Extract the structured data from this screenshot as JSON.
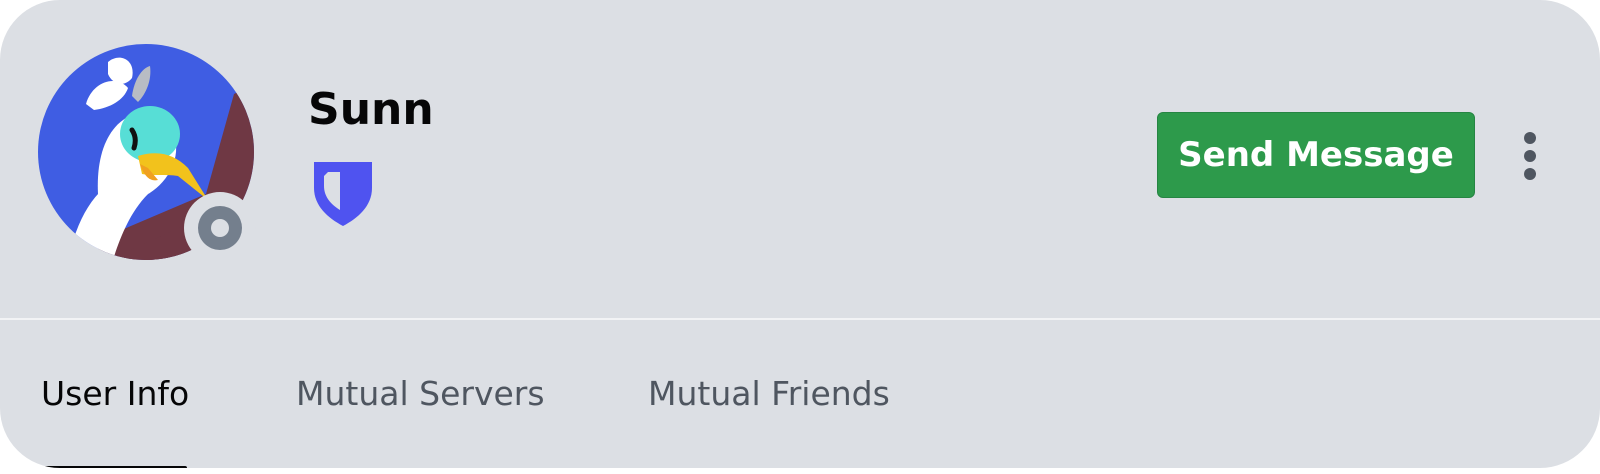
{
  "profile": {
    "username": "Sunn",
    "status": "offline",
    "avatar_icon": "duck-avatar",
    "badge_icon": "hypesquad-bravery-shield-icon"
  },
  "actions": {
    "send_message_label": "Send Message",
    "more_icon": "more-vertical-icon"
  },
  "tabs": [
    {
      "label": "User Info",
      "active": true
    },
    {
      "label": "Mutual Servers",
      "active": false
    },
    {
      "label": "Mutual Friends",
      "active": false
    }
  ],
  "colors": {
    "card_background": "#dcdfe4",
    "send_button": "#2d9a4b",
    "badge": "#4f53f0",
    "status_offline": "#747f8d",
    "avatar_blue": "#3f5de3",
    "avatar_maroon": "#6f3844"
  }
}
